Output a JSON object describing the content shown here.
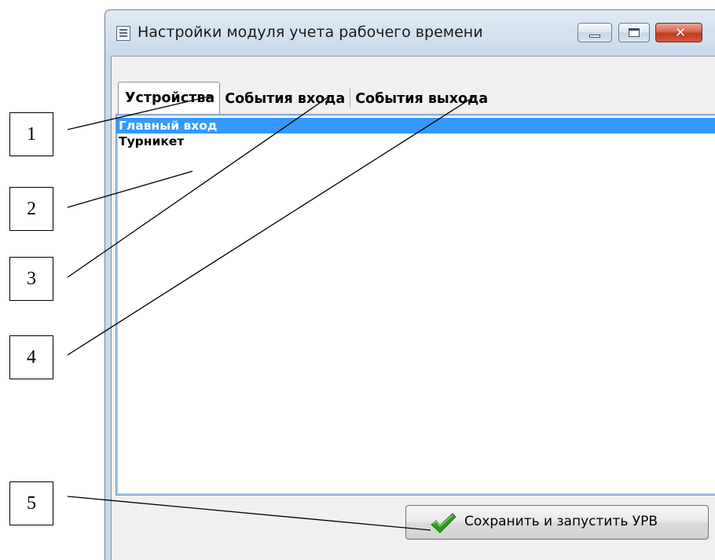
{
  "window": {
    "title": "Настройки модуля учета рабочего времени",
    "icon": "settings-window-icon"
  },
  "caption_buttons": {
    "minimize": "minimize-icon",
    "maximize": "maximize-icon",
    "close_glyph": "✕"
  },
  "tabs": [
    {
      "label": "Устройства",
      "active": true
    },
    {
      "label": "События входа",
      "active": false
    },
    {
      "label": "События выхода",
      "active": false
    }
  ],
  "devices": [
    {
      "label": "Главный вход",
      "selected": true
    },
    {
      "label": "Турникет",
      "selected": false
    }
  ],
  "footer": {
    "save_button_label": "Сохранить и запустить УРВ",
    "save_button_icon": "checkmark-icon"
  },
  "callouts": [
    "1",
    "2",
    "3",
    "4",
    "5"
  ],
  "colors": {
    "selection": "#3399ff",
    "selection_text": "#ffffff",
    "checkmark": "#2e9c1e",
    "close_button": "#c2391f"
  }
}
